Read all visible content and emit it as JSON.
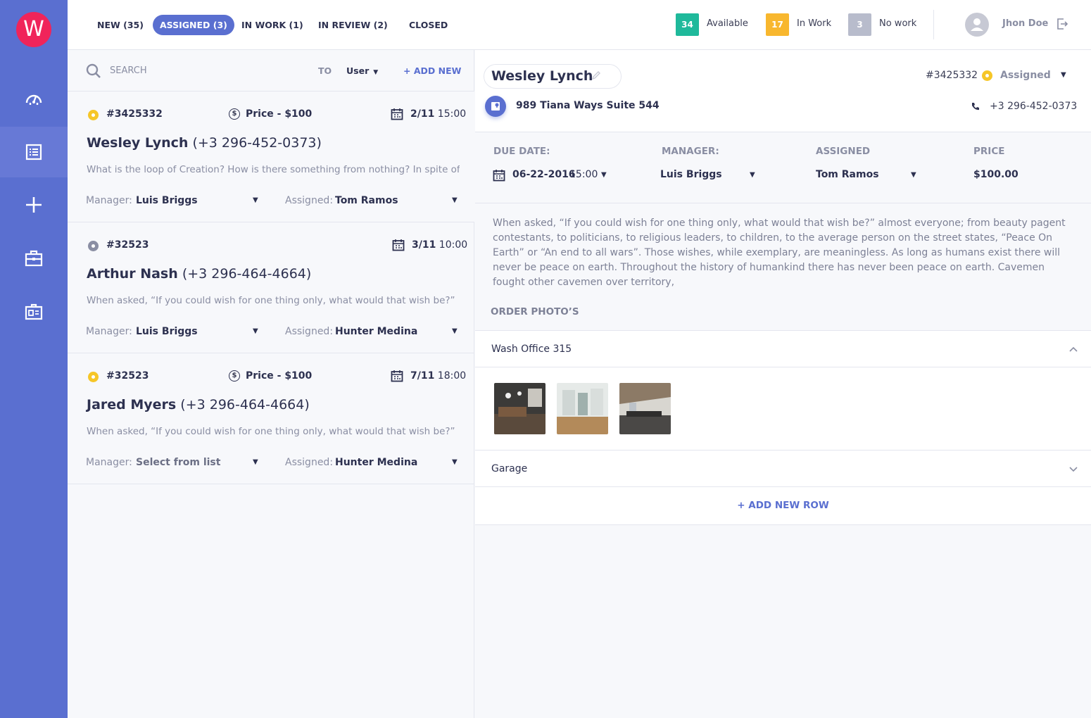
{
  "app": {
    "logo_letter": "W"
  },
  "sidebar": {
    "items": [
      {
        "name": "dashboard",
        "icon": "gauge-icon"
      },
      {
        "name": "orders",
        "icon": "list-icon",
        "active": true
      },
      {
        "name": "add",
        "icon": "plus-icon"
      },
      {
        "name": "jobs",
        "icon": "briefcase-icon"
      },
      {
        "name": "contacts",
        "icon": "id-card-icon"
      }
    ]
  },
  "tabs": [
    {
      "label": "NEW (35)"
    },
    {
      "label": "ASSIGNED (3)",
      "active": true
    },
    {
      "label": "IN WORK (1)"
    },
    {
      "label": "IN REVIEW (2)"
    },
    {
      "label": "CLOSED"
    }
  ],
  "stats": [
    {
      "count": "34",
      "label": "Available",
      "color": "#1fb99b"
    },
    {
      "count": "17",
      "label": "In Work",
      "color": "#f8b72e"
    },
    {
      "count": "3",
      "label": "No work",
      "color": "#b8bccc"
    }
  ],
  "user": {
    "name": "Jhon Doe"
  },
  "search": {
    "placeholder": "SEARCH",
    "to_label": "TO",
    "user_select": "User",
    "add_new": "+ ADD NEW"
  },
  "orders": [
    {
      "id": "#3425332",
      "status_color": "yellow",
      "price": "Price - $100",
      "date": "2/11",
      "time": "15:00",
      "name": "Wesley Lynch",
      "phone": "(+3 296-452-0373)",
      "desc": "What is the loop of Creation? How is there something from nothing? In spite of",
      "manager_label": "Manager:",
      "manager": "Luis Briggs",
      "assigned_label": "Assigned:",
      "assigned": "Tom Ramos"
    },
    {
      "id": "#32523",
      "status_color": "gray",
      "price": "",
      "date": "3/11",
      "time": "10:00",
      "name": "Arthur Nash",
      "phone": "(+3 296-464-4664)",
      "desc": "When asked, “If you could wish for one thing only, what would that wish be?”",
      "manager_label": "Manager:",
      "manager": "Luis Briggs",
      "assigned_label": "Assigned:",
      "assigned": "Hunter Medina"
    },
    {
      "id": "#32523",
      "status_color": "yellow",
      "price": "Price - $100",
      "date": "7/11",
      "time": "18:00",
      "name": "Jared Myers",
      "phone": "(+3 296-464-4664)",
      "desc": "When asked, “If you could wish for one thing only, what would that wish be?”",
      "manager_label": "Manager:",
      "manager": "Select from list",
      "assigned_label": "Assigned:",
      "assigned": "Hunter Medina"
    }
  ],
  "detail": {
    "name": "Wesley Lynch",
    "id": "#3425332",
    "status": "Assigned",
    "address": "989 Tiana Ways Suite 544",
    "phone": "+3 296-452-0373",
    "due_label": "DUE DATE:",
    "due_date": "06-22-2016",
    "due_time": "15:00",
    "manager_label": "MANAGER:",
    "manager": "Luis Briggs",
    "assigned_label": "ASSIGNED",
    "assigned": "Tom Ramos",
    "price_label": "PRICE",
    "price": "$100.00",
    "description": "When asked, “If you could wish for one thing only, what would that wish be?” almost everyone; from beauty pagent contestants, to politicians, to religious leaders, to children, to the average person on the street states, “Peace On Earth” or “An end to all wars”. Those wishes, while exemplary, are meaningless. As long as humans exist there will never be peace on earth. Throughout the history of humankind there has never been peace on earth. Cavemen fought other cavemen over territory,",
    "photos_title": "ORDER PHOTO’S",
    "sections": [
      {
        "label": "Wash Office 315",
        "expanded": true
      },
      {
        "label": "Garage",
        "expanded": false
      }
    ],
    "add_row": "+ ADD NEW ROW"
  }
}
